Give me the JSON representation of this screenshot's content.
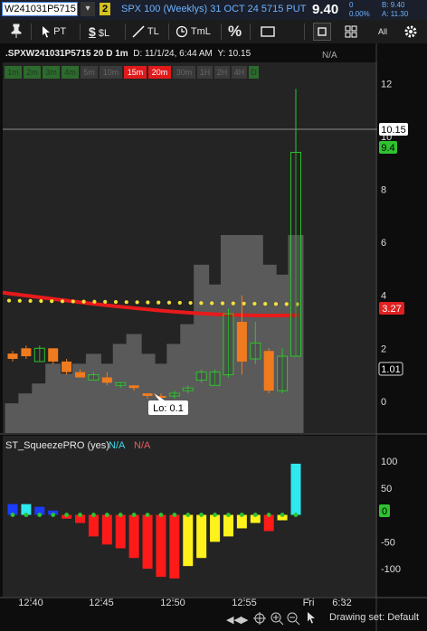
{
  "header": {
    "symbol": "W241031P5715",
    "link_group": "2",
    "description": "SPX 100 (Weeklys) 31 OCT 24 5715 PUT",
    "last": "9.40",
    "net_change": "0",
    "pct_change": "0.00%",
    "bid": "B: 9.40",
    "ask": "A: 11.30"
  },
  "toolbar": {
    "pointer_label": "PT",
    "price_label": "$L",
    "trendline_label": "TL",
    "time_label": "TmL",
    "percent_label": "%",
    "all_label": "All"
  },
  "chart": {
    "status_symbol": ".SPXW241031P5715 20 D 1m",
    "status_date": "D: 11/1/24, 6:44 AM",
    "status_y": "Y: 10.15",
    "na_label": "N/A",
    "aggregations": [
      "1m",
      "2m",
      "3m",
      "4m",
      "5m",
      "10m",
      "15m",
      "20m",
      "30m",
      "1H",
      "2H",
      "4H",
      "D"
    ],
    "price_tag_last": "10.15",
    "price_tag_high": "9.4",
    "price_tag_ma": "3.27",
    "price_tag_cur": "1.01",
    "low_bubble": "Lo: 0.1",
    "y_ticks": [
      "12",
      "10",
      "8",
      "6",
      "4",
      "2",
      "0"
    ],
    "study_name": "ST_SqueezePRO (yes)",
    "study_val1": "N/A",
    "study_val2": "N/A",
    "study_ticks": [
      "100",
      "50",
      "0",
      "-50",
      "-100"
    ],
    "study_zero_tag": "0",
    "time_labels": [
      "12:40",
      "12:45",
      "12:50",
      "12:55",
      "Fri",
      "6:32"
    ],
    "drawing_set": "Drawing set: Default"
  },
  "chart_data": {
    "type": "candlestick",
    "price_range": [
      -1.2,
      12.8
    ],
    "candles": [
      {
        "o": 1.6,
        "c": 1.8,
        "h": 1.9,
        "l": 1.5,
        "up": false
      },
      {
        "o": 2.0,
        "c": 1.7,
        "h": 2.1,
        "l": 1.6,
        "up": false
      },
      {
        "o": 1.5,
        "c": 2.0,
        "h": 2.1,
        "l": 1.5,
        "up": true
      },
      {
        "o": 2.0,
        "c": 1.5,
        "h": 2.0,
        "l": 1.4,
        "up": false
      },
      {
        "o": 1.5,
        "c": 1.1,
        "h": 1.6,
        "l": 1.0,
        "up": false
      },
      {
        "o": 1.1,
        "c": 0.9,
        "h": 1.2,
        "l": 0.9,
        "up": false
      },
      {
        "o": 0.8,
        "c": 1.0,
        "h": 1.1,
        "l": 0.8,
        "up": true
      },
      {
        "o": 0.9,
        "c": 0.7,
        "h": 1.1,
        "l": 0.6,
        "up": false
      },
      {
        "o": 0.6,
        "c": 0.7,
        "h": 0.7,
        "l": 0.5,
        "up": true
      },
      {
        "o": 0.6,
        "c": 0.5,
        "h": 0.6,
        "l": 0.4,
        "up": false
      },
      {
        "o": 0.3,
        "c": 0.2,
        "h": 0.3,
        "l": 0.1,
        "up": false
      },
      {
        "o": 0.2,
        "c": 0.2,
        "h": 0.3,
        "l": 0.1,
        "up": false
      },
      {
        "o": 0.2,
        "c": 0.3,
        "h": 0.4,
        "l": 0.1,
        "up": true
      },
      {
        "o": 0.4,
        "c": 0.5,
        "h": 0.6,
        "l": 0.3,
        "up": true
      },
      {
        "o": 0.8,
        "c": 1.1,
        "h": 1.2,
        "l": 0.7,
        "up": true
      },
      {
        "o": 0.6,
        "c": 1.1,
        "h": 1.2,
        "l": 0.6,
        "up": true
      },
      {
        "o": 1.0,
        "c": 3.3,
        "h": 3.5,
        "l": 0.9,
        "up": true
      },
      {
        "o": 3.0,
        "c": 1.5,
        "h": 4.0,
        "l": 1.0,
        "up": false
      },
      {
        "o": 1.6,
        "c": 2.2,
        "h": 3.0,
        "l": 1.4,
        "up": true
      },
      {
        "o": 1.9,
        "c": 0.4,
        "h": 2.0,
        "l": 0.3,
        "up": false
      },
      {
        "o": 0.4,
        "c": 1.7,
        "h": 2.0,
        "l": 0.3,
        "up": true
      },
      {
        "o": 1.7,
        "c": 9.4,
        "h": 11.8,
        "l": 1.7,
        "up": true
      }
    ],
    "volume": [
      0.15,
      0.2,
      0.25,
      0.35,
      0.3,
      0.35,
      0.4,
      0.35,
      0.45,
      0.5,
      0.4,
      0.35,
      0.45,
      0.55,
      0.85,
      0.75,
      1.0,
      1.0,
      1.0,
      0.85,
      0.8,
      1.0
    ],
    "ma_start": 4.1,
    "ma_end": 3.25,
    "dots_level": 3.8,
    "squeeze": [
      {
        "v": 20,
        "c": "blue"
      },
      {
        "v": 20,
        "c": "cyan"
      },
      {
        "v": 15,
        "c": "blue"
      },
      {
        "v": 8,
        "c": "blue"
      },
      {
        "v": -7,
        "c": "red"
      },
      {
        "v": -15,
        "c": "red"
      },
      {
        "v": -40,
        "c": "red"
      },
      {
        "v": -55,
        "c": "red"
      },
      {
        "v": -62,
        "c": "red"
      },
      {
        "v": -80,
        "c": "red"
      },
      {
        "v": -100,
        "c": "red"
      },
      {
        "v": -115,
        "c": "red"
      },
      {
        "v": -118,
        "c": "red"
      },
      {
        "v": -95,
        "c": "yellow"
      },
      {
        "v": -80,
        "c": "yellow"
      },
      {
        "v": -50,
        "c": "yellow"
      },
      {
        "v": -40,
        "c": "yellow"
      },
      {
        "v": -25,
        "c": "yellow"
      },
      {
        "v": -15,
        "c": "yellow"
      },
      {
        "v": -30,
        "c": "red"
      },
      {
        "v": -10,
        "c": "yellow"
      },
      {
        "v": 95,
        "c": "cyan"
      }
    ],
    "squeeze_range": [
      -135,
      110
    ]
  }
}
